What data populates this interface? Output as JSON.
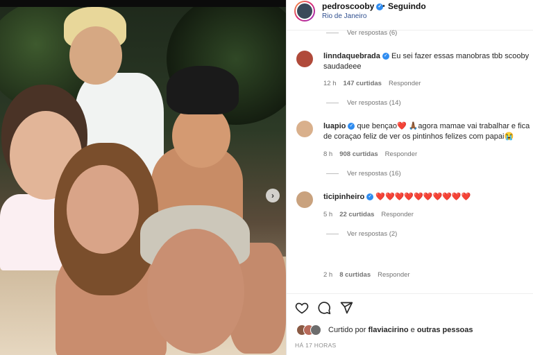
{
  "header": {
    "username": "pedroscooby",
    "separator": "•",
    "follow_state": "Seguindo",
    "location": "Rio de Janeiro",
    "verified_icon": "✓"
  },
  "thread": {
    "top_replies": "Ver respostas (6)",
    "comments": [
      {
        "username": "linndaquebrada",
        "text": "Eu sei fazer essas manobras tbb scooby saudadeee",
        "time": "12 h",
        "likes": "147 curtidas",
        "reply": "Responder",
        "replies": "Ver respostas (14)",
        "avatar_color": "#b04a3a"
      },
      {
        "username": "luapio",
        "text": "que bençao❤️ 🙏🏾agora mamae vai trabalhar e fica de coraçao feliz de ver os pintinhos felizes com papai😭",
        "time": "8 h",
        "likes": "908 curtidas",
        "reply": "Responder",
        "replies": "Ver respostas (16)",
        "avatar_color": "#d9b08c"
      },
      {
        "username": "ticipinheiro",
        "text": "❤️❤️❤️❤️❤️❤️❤️❤️❤️❤️",
        "time": "5 h",
        "likes": "22 curtidas",
        "reply": "Responder",
        "replies": "Ver respostas (2)",
        "avatar_color": "#c9a27e"
      }
    ],
    "last_meta": {
      "time": "2 h",
      "likes": "8 curtidas",
      "reply": "Responder"
    }
  },
  "actions": {
    "like_icon": "heart-icon",
    "comment_icon": "comment-icon",
    "share_icon": "share-icon",
    "liked_prefix": "Curtido por",
    "liked_user": "flaviacirino",
    "liked_join": "e",
    "liked_others": "outras pessoas",
    "posted_time": "HÁ 17 HORAS"
  },
  "photo": {
    "next_arrow": "›"
  },
  "colors": {
    "verified": "#2f8cf0",
    "meta_gray": "#737373",
    "location": "#2f4f8f"
  }
}
